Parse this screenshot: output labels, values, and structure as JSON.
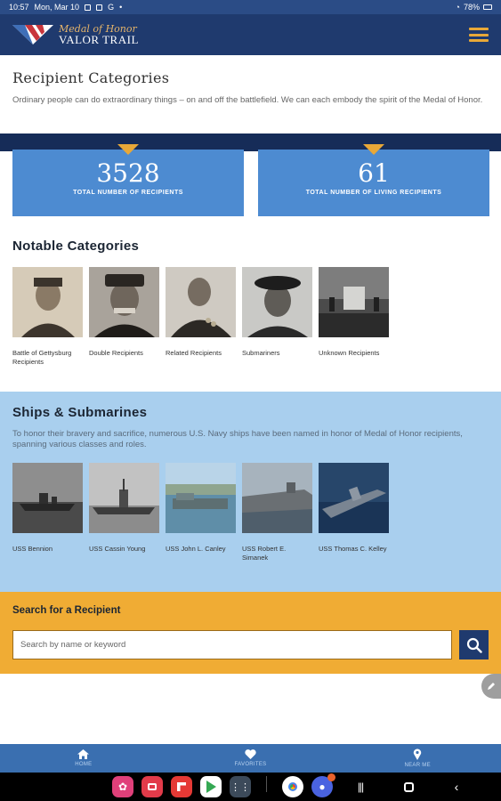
{
  "status_bar": {
    "time": "10:57",
    "date": "Mon, Mar 10",
    "battery": "78%"
  },
  "header": {
    "logo_top": "Medal of Honor",
    "logo_bottom": "VALOR TRAIL"
  },
  "intro": {
    "title": "Recipient Categories",
    "description": "Ordinary people can do extraordinary things – on and off the battlefield. We can each embody the spirit of the Medal of Honor."
  },
  "stats": [
    {
      "value": "3528",
      "label": "TOTAL NUMBER OF RECIPIENTS"
    },
    {
      "value": "61",
      "label": "TOTAL NUMBER OF LIVING RECIPIENTS"
    }
  ],
  "notable": {
    "title": "Notable Categories",
    "items": [
      {
        "label": "Battle of Gettysburg Recipients"
      },
      {
        "label": "Double Recipients"
      },
      {
        "label": "Related Recipients"
      },
      {
        "label": "Submariners"
      },
      {
        "label": "Unknown Recipients"
      }
    ]
  },
  "ships": {
    "title": "Ships & Submarines",
    "description": "To honor their bravery and sacrifice, numerous U.S. Navy ships have been named in honor of Medal of Honor recipients, spanning various classes and roles.",
    "items": [
      {
        "label": "USS Bennion"
      },
      {
        "label": "USS Cassin Young"
      },
      {
        "label": "USS John L. Canley"
      },
      {
        "label": "USS Robert E. Simanek"
      },
      {
        "label": "USS Thomas C. Kelley"
      }
    ]
  },
  "search": {
    "title": "Search for a Recipient",
    "placeholder": "Search by name or keyword"
  },
  "tabs": [
    {
      "label": "HOME",
      "icon": "home-icon"
    },
    {
      "label": "FAVORITES",
      "icon": "heart-icon"
    },
    {
      "label": "NEAR ME",
      "icon": "location-pin-icon"
    }
  ],
  "colors": {
    "header": "#1f3a6e",
    "accent_gold": "#e8a838",
    "stat_blue": "#4d8bd1",
    "ships_bg": "#a9cfee",
    "search_bg": "#f0ac34",
    "tabbar": "#3a6fb0"
  }
}
